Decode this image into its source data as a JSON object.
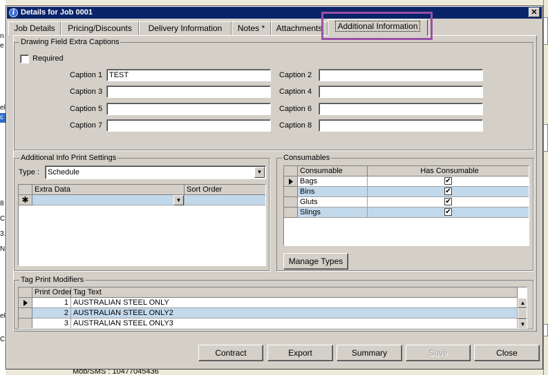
{
  "window": {
    "title": "Details for Job 0001"
  },
  "tabs": [
    {
      "label": "Job Details"
    },
    {
      "label": "Pricing/Discounts"
    },
    {
      "label": "Delivery Information"
    },
    {
      "label": "Notes *"
    },
    {
      "label": "Attachments"
    },
    {
      "label": "Additional Information"
    }
  ],
  "drawing": {
    "group_label": "Drawing Field Extra Captions",
    "required_label": "Required",
    "captions": [
      {
        "label": "Caption 1",
        "value": "TEST"
      },
      {
        "label": "Caption 2",
        "value": ""
      },
      {
        "label": "Caption 3",
        "value": ""
      },
      {
        "label": "Caption 4",
        "value": ""
      },
      {
        "label": "Caption 5",
        "value": ""
      },
      {
        "label": "Caption 6",
        "value": ""
      },
      {
        "label": "Caption 7",
        "value": ""
      },
      {
        "label": "Caption 8",
        "value": ""
      }
    ]
  },
  "print_settings": {
    "group_label": "Additional Info Print Settings",
    "type_label": "Type :",
    "type_value": "Schedule",
    "columns": [
      "Extra Data",
      "Sort Order"
    ],
    "new_row_marker": "✱"
  },
  "consumables": {
    "group_label": "Consumables",
    "columns": [
      "Consumable",
      "Has Consumable"
    ],
    "rows": [
      {
        "name": "Bags",
        "checked": "✔"
      },
      {
        "name": "Bins",
        "checked": "✔"
      },
      {
        "name": "Gluts",
        "checked": "✔"
      },
      {
        "name": "Slings",
        "checked": "✔"
      }
    ],
    "manage_label": "Manage Types"
  },
  "tag_modifiers": {
    "group_label": "Tag Print Modifiers",
    "columns": [
      "Print Order",
      "Tag Text"
    ],
    "rows": [
      {
        "order": "1",
        "text": "AUSTRALIAN STEEL ONLY"
      },
      {
        "order": "2",
        "text": "AUSTRALIAN STEEL ONLY2"
      },
      {
        "order": "3",
        "text": "AUSTRALIAN STEEL ONLY3"
      }
    ]
  },
  "buttons": {
    "contract": "Contract",
    "export": "Export",
    "summary": "Summary",
    "save": "Save",
    "close": "Close"
  },
  "background": {
    "mobile": "Mob/SMS : 10477045436",
    "strip": [
      "n",
      "e",
      "",
      "",
      "",
      "",
      "el",
      "c",
      "",
      "8",
      "C",
      "3.",
      "N",
      "",
      "",
      "",
      "el",
      "C"
    ]
  },
  "icons": {
    "info": "info-icon",
    "close": "close-icon",
    "dropdown": "chevron-down-icon",
    "row_pointer": "row-pointer-icon"
  },
  "colors": {
    "title_bar": "#0a246a",
    "selected_row": "#c2d9ec",
    "highlight_box": "#9b4fa8"
  }
}
